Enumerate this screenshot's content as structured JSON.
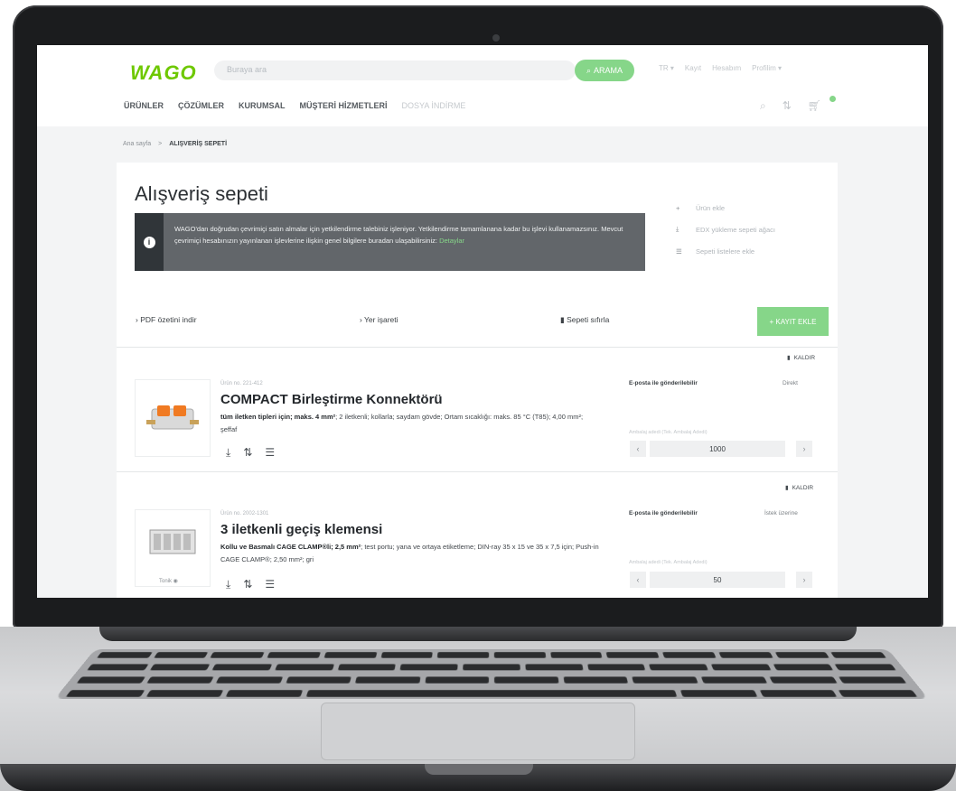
{
  "header": {
    "logo": "WAGO",
    "search_placeholder": "Buraya ara",
    "search_button": "ARAMA",
    "meta": [
      "TR ▾",
      "Kayıt",
      "Hesabım",
      "Profilim ▾"
    ],
    "nav": [
      {
        "label": "ÜRÜNLER",
        "light": false
      },
      {
        "label": "ÇÖZÜMLER",
        "light": false
      },
      {
        "label": "KURUMSAL",
        "light": false
      },
      {
        "label": "MÜŞTERİ HİZMETLERİ",
        "light": false
      },
      {
        "label": "DOSYA İNDİRME",
        "light": true
      }
    ]
  },
  "breadcrumb": {
    "home": "Ana sayfa",
    "sep": ">",
    "current": "ALIŞVERİŞ SEPETİ"
  },
  "page_title": "Alışveriş sepeti",
  "info": {
    "text": "WAGO'dan doğrudan çevrimiçi satın almalar için yetkilendirme talebiniz işleniyor. Yetkilendirme tamamlanana kadar bu işlevi kullanamazsınız. Mevcut çevrimiçi hesabınızın yayınlanan işlevlerine ilişkin genel bilgilere buradan ulaşabilirsiniz:",
    "link": "Detaylar"
  },
  "right_actions": [
    {
      "icon": "+",
      "label": "Ürün ekle"
    },
    {
      "icon": "⤓",
      "label": "EDX yükleme sepeti ağacı"
    },
    {
      "icon": "☰",
      "label": "Sepeti listelere ekle"
    }
  ],
  "toolbar": {
    "pdf": "PDF özetini indir",
    "bookmark": "Yer işareti",
    "clear": "Sepeti sıfırla",
    "add": "+ KAYIT EKLE"
  },
  "items": [
    {
      "remove": "KALDIR",
      "code": "Ürün no. 221-412",
      "title": "COMPACT Birleştirme Konnektörü",
      "desc_bold": "tüm iletken tipleri için; maks. 4 mm²",
      "desc": "; 2 iletkenli; kollarla; saydam gövde; Ortam sıcaklığı: maks. 85 °C (T85); 4,00 mm²; şeffaf",
      "ship_label": "E-posta ile gönderilebilir",
      "ship_val": "Direkt",
      "qty_label": "Ambalaj adedi (Tek. Ambalaj Adedi)",
      "qty": "1000"
    },
    {
      "remove": "KALDIR",
      "code": "Ürün no. 2002-1301",
      "title": "3 iletkenli geçiş klemensi",
      "desc_bold": "Kollu ve Basmalı CAGE CLAMP®li; 2,5 mm²",
      "desc": "; test portu; yana ve ortaya etiketleme; DIN-ray 35 x 15 ve 35 x 7,5 için; Push-in CAGE CLAMP®; 2,50 mm²; gri",
      "thumb_label": "Tonik ◉",
      "ship_label": "E-posta ile gönderilebilir",
      "ship_val": "İstek üzerine",
      "qty_label": "Ambalaj adedi (Tek. Ambalaj Adedi)",
      "qty": "50"
    }
  ]
}
